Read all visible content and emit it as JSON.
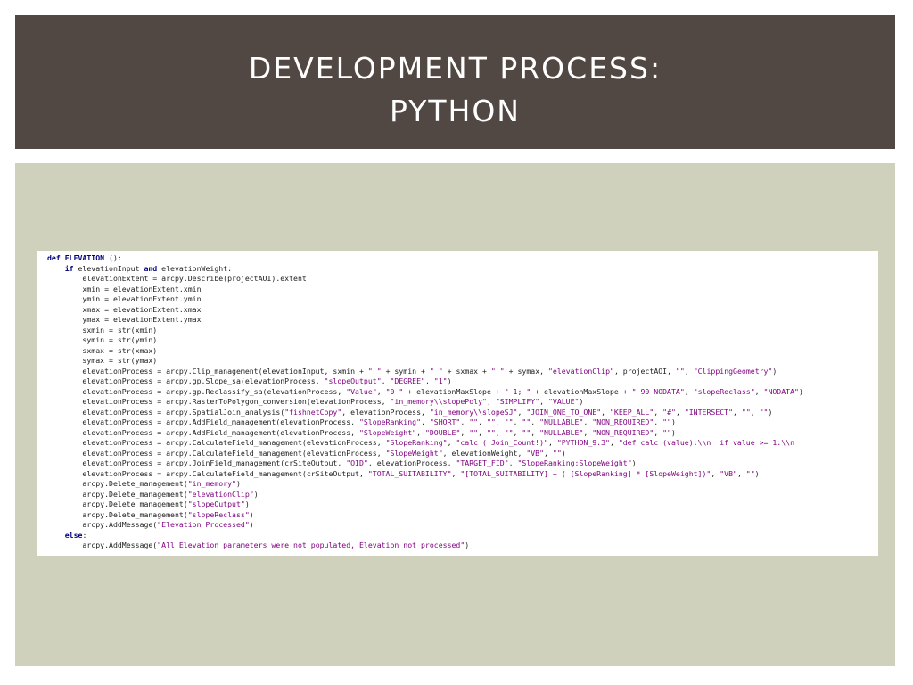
{
  "slide": {
    "title_line1": "DEVELOPMENT PROCESS:",
    "title_line2": "PYTHON"
  },
  "code": {
    "lines": [
      [
        {
          "k": "kw",
          "t": "def "
        },
        {
          "k": "kw",
          "t": "ELEVATION"
        },
        {
          "k": "n",
          "t": " ():"
        }
      ],
      [
        {
          "k": "n",
          "t": "    "
        },
        {
          "k": "kw",
          "t": "if"
        },
        {
          "k": "n",
          "t": " elevationInput "
        },
        {
          "k": "kw",
          "t": "and"
        },
        {
          "k": "n",
          "t": " elevationWeight:"
        }
      ],
      [
        {
          "k": "n",
          "t": "        elevationExtent = arcpy.Describe(projectAOI).extent"
        }
      ],
      [
        {
          "k": "n",
          "t": "        xmin = elevationExtent.xmin"
        }
      ],
      [
        {
          "k": "n",
          "t": "        ymin = elevationExtent.ymin"
        }
      ],
      [
        {
          "k": "n",
          "t": "        xmax = elevationExtent.xmax"
        }
      ],
      [
        {
          "k": "n",
          "t": "        ymax = elevationExtent.ymax"
        }
      ],
      [
        {
          "k": "n",
          "t": "        sxmin = str(xmin)"
        }
      ],
      [
        {
          "k": "n",
          "t": "        symin = str(ymin)"
        }
      ],
      [
        {
          "k": "n",
          "t": "        sxmax = str(xmax)"
        }
      ],
      [
        {
          "k": "n",
          "t": "        symax = str(ymax)"
        }
      ],
      [
        {
          "k": "n",
          "t": "        elevationProcess = arcpy.Clip_management(elevationInput, sxmin + "
        },
        {
          "k": "str",
          "t": "\" \""
        },
        {
          "k": "n",
          "t": " + symin + "
        },
        {
          "k": "str",
          "t": "\" \""
        },
        {
          "k": "n",
          "t": " + sxmax + "
        },
        {
          "k": "str",
          "t": "\" \""
        },
        {
          "k": "n",
          "t": " + symax, "
        },
        {
          "k": "str",
          "t": "\"elevationClip\""
        },
        {
          "k": "n",
          "t": ", projectAOI, "
        },
        {
          "k": "str",
          "t": "\"\""
        },
        {
          "k": "n",
          "t": ", "
        },
        {
          "k": "str",
          "t": "\"ClippingGeometry\""
        },
        {
          "k": "n",
          "t": ")"
        }
      ],
      [
        {
          "k": "n",
          "t": "        elevationProcess = arcpy.gp.Slope_sa(elevationProcess, "
        },
        {
          "k": "str",
          "t": "\"slopeOutput\""
        },
        {
          "k": "n",
          "t": ", "
        },
        {
          "k": "str",
          "t": "\"DEGREE\""
        },
        {
          "k": "n",
          "t": ", "
        },
        {
          "k": "str",
          "t": "\"1\""
        },
        {
          "k": "n",
          "t": ")"
        }
      ],
      [
        {
          "k": "n",
          "t": "        elevationProcess = arcpy.gp.Reclassify_sa(elevationProcess, "
        },
        {
          "k": "str",
          "t": "\"Value\""
        },
        {
          "k": "n",
          "t": ", "
        },
        {
          "k": "str",
          "t": "\"0 \""
        },
        {
          "k": "n",
          "t": " + elevationMaxSlope + "
        },
        {
          "k": "str",
          "t": "\" 1; \""
        },
        {
          "k": "n",
          "t": " + elevationMaxSlope + "
        },
        {
          "k": "str",
          "t": "\" 90 NODATA\""
        },
        {
          "k": "n",
          "t": ", "
        },
        {
          "k": "str",
          "t": "\"slopeReclass\""
        },
        {
          "k": "n",
          "t": ", "
        },
        {
          "k": "str",
          "t": "\"NODATA\""
        },
        {
          "k": "n",
          "t": ")"
        }
      ],
      [
        {
          "k": "n",
          "t": "        elevationProcess = arcpy.RasterToPolygon_conversion(elevationProcess, "
        },
        {
          "k": "str",
          "t": "\"in_memory\\\\slopePoly\""
        },
        {
          "k": "n",
          "t": ", "
        },
        {
          "k": "str",
          "t": "\"SIMPLIFY\""
        },
        {
          "k": "n",
          "t": ", "
        },
        {
          "k": "str",
          "t": "\"VALUE\""
        },
        {
          "k": "n",
          "t": ")"
        }
      ],
      [
        {
          "k": "n",
          "t": "        elevationProcess = arcpy.SpatialJoin_analysis("
        },
        {
          "k": "str",
          "t": "\"fishnetCopy\""
        },
        {
          "k": "n",
          "t": ", elevationProcess, "
        },
        {
          "k": "str",
          "t": "\"in_memory\\\\slopeSJ\""
        },
        {
          "k": "n",
          "t": ", "
        },
        {
          "k": "str",
          "t": "\"JOIN_ONE_TO_ONE\""
        },
        {
          "k": "n",
          "t": ", "
        },
        {
          "k": "str",
          "t": "\"KEEP_ALL\""
        },
        {
          "k": "n",
          "t": ", "
        },
        {
          "k": "str",
          "t": "\"#\""
        },
        {
          "k": "n",
          "t": ", "
        },
        {
          "k": "str",
          "t": "\"INTERSECT\""
        },
        {
          "k": "n",
          "t": ", "
        },
        {
          "k": "str",
          "t": "\"\""
        },
        {
          "k": "n",
          "t": ", "
        },
        {
          "k": "str",
          "t": "\"\""
        },
        {
          "k": "n",
          "t": ")"
        }
      ],
      [
        {
          "k": "n",
          "t": "        elevationProcess = arcpy.AddField_management(elevationProcess, "
        },
        {
          "k": "str",
          "t": "\"SlopeRanking\""
        },
        {
          "k": "n",
          "t": ", "
        },
        {
          "k": "str",
          "t": "\"SHORT\""
        },
        {
          "k": "n",
          "t": ", "
        },
        {
          "k": "str",
          "t": "\"\""
        },
        {
          "k": "n",
          "t": ", "
        },
        {
          "k": "str",
          "t": "\"\""
        },
        {
          "k": "n",
          "t": ", "
        },
        {
          "k": "str",
          "t": "\"\""
        },
        {
          "k": "n",
          "t": ", "
        },
        {
          "k": "str",
          "t": "\"\""
        },
        {
          "k": "n",
          "t": ", "
        },
        {
          "k": "str",
          "t": "\"NULLABLE\""
        },
        {
          "k": "n",
          "t": ", "
        },
        {
          "k": "str",
          "t": "\"NON_REQUIRED\""
        },
        {
          "k": "n",
          "t": ", "
        },
        {
          "k": "str",
          "t": "\"\""
        },
        {
          "k": "n",
          "t": ")"
        }
      ],
      [
        {
          "k": "n",
          "t": "        elevationProcess = arcpy.AddField_management(elevationProcess, "
        },
        {
          "k": "str",
          "t": "\"SlopeWeight\""
        },
        {
          "k": "n",
          "t": ", "
        },
        {
          "k": "str",
          "t": "\"DOUBLE\""
        },
        {
          "k": "n",
          "t": ", "
        },
        {
          "k": "str",
          "t": "\"\""
        },
        {
          "k": "n",
          "t": ", "
        },
        {
          "k": "str",
          "t": "\"\""
        },
        {
          "k": "n",
          "t": ", "
        },
        {
          "k": "str",
          "t": "\"\""
        },
        {
          "k": "n",
          "t": ", "
        },
        {
          "k": "str",
          "t": "\"\""
        },
        {
          "k": "n",
          "t": ", "
        },
        {
          "k": "str",
          "t": "\"NULLABLE\""
        },
        {
          "k": "n",
          "t": ", "
        },
        {
          "k": "str",
          "t": "\"NON_REQUIRED\""
        },
        {
          "k": "n",
          "t": ", "
        },
        {
          "k": "str",
          "t": "\"\""
        },
        {
          "k": "n",
          "t": ")"
        }
      ],
      [
        {
          "k": "n",
          "t": "        elevationProcess = arcpy.CalculateField_management(elevationProcess, "
        },
        {
          "k": "str",
          "t": "\"SlopeRanking\""
        },
        {
          "k": "n",
          "t": ", "
        },
        {
          "k": "str",
          "t": "\"calc (!Join_Count!)\""
        },
        {
          "k": "n",
          "t": ", "
        },
        {
          "k": "str",
          "t": "\"PYTHON_9.3\""
        },
        {
          "k": "n",
          "t": ", "
        },
        {
          "k": "str",
          "t": "\"def calc (value):\\\\n  if value >= 1:\\\\n"
        }
      ],
      [
        {
          "k": "n",
          "t": "        elevationProcess = arcpy.CalculateField_management(elevationProcess, "
        },
        {
          "k": "str",
          "t": "\"SlopeWeight\""
        },
        {
          "k": "n",
          "t": ", elevationWeight, "
        },
        {
          "k": "str",
          "t": "\"VB\""
        },
        {
          "k": "n",
          "t": ", "
        },
        {
          "k": "str",
          "t": "\"\""
        },
        {
          "k": "n",
          "t": ")"
        }
      ],
      [
        {
          "k": "n",
          "t": "        elevationProcess = arcpy.JoinField_management(crSiteOutput, "
        },
        {
          "k": "str",
          "t": "\"OID\""
        },
        {
          "k": "n",
          "t": ", elevationProcess, "
        },
        {
          "k": "str",
          "t": "\"TARGET_FID\""
        },
        {
          "k": "n",
          "t": ", "
        },
        {
          "k": "str",
          "t": "\"SlopeRanking;SlopeWeight\""
        },
        {
          "k": "n",
          "t": ")"
        }
      ],
      [
        {
          "k": "n",
          "t": "        elevationProcess = arcpy.CalculateField_management(crSiteOutput, "
        },
        {
          "k": "str",
          "t": "\"TOTAL_SUITABILITY\""
        },
        {
          "k": "n",
          "t": ", "
        },
        {
          "k": "str",
          "t": "\"[TOTAL_SUITABILITY] + ( [SlopeRanking] * [SlopeWeight])\""
        },
        {
          "k": "n",
          "t": ", "
        },
        {
          "k": "str",
          "t": "\"VB\""
        },
        {
          "k": "n",
          "t": ", "
        },
        {
          "k": "str",
          "t": "\"\""
        },
        {
          "k": "n",
          "t": ")"
        }
      ],
      [
        {
          "k": "n",
          "t": "        arcpy.Delete_management("
        },
        {
          "k": "str",
          "t": "\"in_memory\""
        },
        {
          "k": "n",
          "t": ")"
        }
      ],
      [
        {
          "k": "n",
          "t": "        arcpy.Delete_management("
        },
        {
          "k": "str",
          "t": "\"elevationClip\""
        },
        {
          "k": "n",
          "t": ")"
        }
      ],
      [
        {
          "k": "n",
          "t": "        arcpy.Delete_management("
        },
        {
          "k": "str",
          "t": "\"slopeOutput\""
        },
        {
          "k": "n",
          "t": ")"
        }
      ],
      [
        {
          "k": "n",
          "t": "        arcpy.Delete_management("
        },
        {
          "k": "str",
          "t": "\"slopeReclass\""
        },
        {
          "k": "n",
          "t": ")"
        }
      ],
      [
        {
          "k": "n",
          "t": "        arcpy.AddMessage("
        },
        {
          "k": "str",
          "t": "\"Elevation Processed\""
        },
        {
          "k": "n",
          "t": ")"
        }
      ],
      [
        {
          "k": "n",
          "t": "    "
        },
        {
          "k": "kw",
          "t": "else"
        },
        {
          "k": "n",
          "t": ":"
        }
      ],
      [
        {
          "k": "n",
          "t": "        arcpy.AddMessage("
        },
        {
          "k": "str",
          "t": "\"All Elevation parameters were not populated, Elevation not processed\""
        },
        {
          "k": "n",
          "t": ")"
        }
      ]
    ]
  }
}
